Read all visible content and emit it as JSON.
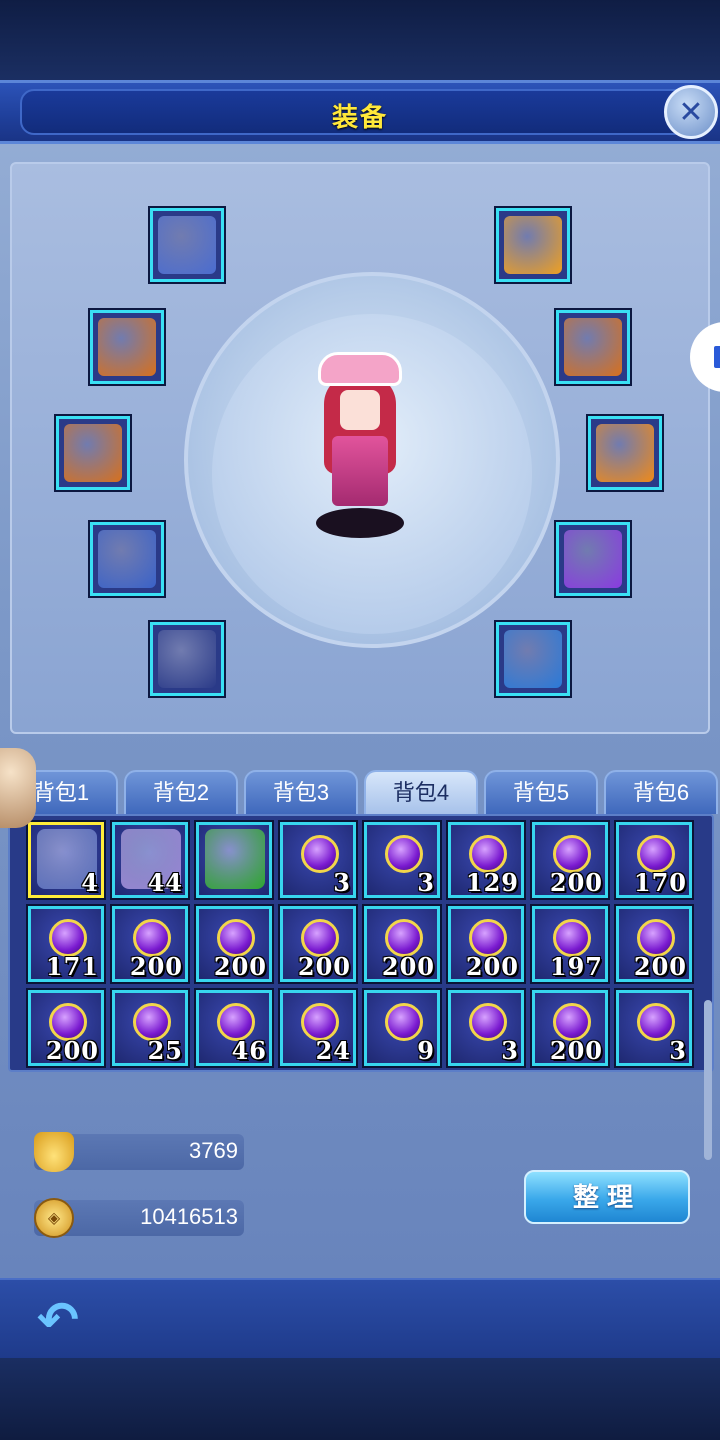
{
  "header": {
    "title": "装备"
  },
  "equipment": {
    "left": [
      {
        "name": "weapon-slot",
        "icon": "weapon-icon",
        "color": "#4a6cd0"
      },
      {
        "name": "necklace-slot",
        "icon": "jade-necklace-icon",
        "color": "#d8701c"
      },
      {
        "name": "armor-slot",
        "icon": "armor-icon",
        "color": "#d8701c"
      },
      {
        "name": "boots-slot",
        "icon": "boots-icon",
        "color": "#3a62c8"
      },
      {
        "name": "amulet-slot",
        "icon": "medallion-icon",
        "color": "#2a3a88"
      }
    ],
    "right": [
      {
        "name": "hat-slot",
        "icon": "hat-icon",
        "color": "#f0a020"
      },
      {
        "name": "robe-slot",
        "icon": "robe-icon",
        "color": "#d8701c"
      },
      {
        "name": "belt-slot",
        "icon": "belt-icon",
        "color": "#f08a18"
      },
      {
        "name": "bracer-slot",
        "icon": "bracer-icon",
        "color": "#8a3ae0"
      },
      {
        "name": "orb-slot",
        "icon": "yin-yang-orb-icon",
        "color": "#2a7ad8"
      }
    ]
  },
  "tabs": [
    "背包1",
    "背包2",
    "背包3",
    "背包4",
    "背包5",
    "背包6"
  ],
  "active_tab": 3,
  "bag": [
    {
      "icon": "sword-icon",
      "count": "4",
      "selected": true,
      "special": "#5a70c0"
    },
    {
      "icon": "ore-icon",
      "count": "44",
      "special": "#9a86d8"
    },
    {
      "icon": "green-rune-icon",
      "count": "",
      "special": "#2ea830"
    },
    {
      "icon": "purple-gem-icon",
      "count": "3"
    },
    {
      "icon": "purple-gem-icon",
      "count": "3"
    },
    {
      "icon": "purple-gem-icon",
      "count": "129"
    },
    {
      "icon": "purple-gem-icon",
      "count": "200"
    },
    {
      "icon": "purple-gem-icon",
      "count": "170"
    },
    {
      "icon": "purple-gem-icon",
      "count": "171"
    },
    {
      "icon": "purple-gem-icon",
      "count": "200"
    },
    {
      "icon": "purple-gem-icon",
      "count": "200"
    },
    {
      "icon": "purple-gem-icon",
      "count": "200"
    },
    {
      "icon": "purple-gem-icon",
      "count": "200"
    },
    {
      "icon": "purple-gem-icon",
      "count": "200"
    },
    {
      "icon": "purple-gem-icon",
      "count": "197"
    },
    {
      "icon": "purple-gem-icon",
      "count": "200"
    },
    {
      "icon": "purple-gem-icon",
      "count": "200"
    },
    {
      "icon": "purple-gem-icon",
      "count": "25"
    },
    {
      "icon": "purple-gem-icon",
      "count": "46"
    },
    {
      "icon": "purple-gem-icon",
      "count": "24"
    },
    {
      "icon": "purple-gem-icon",
      "count": "9"
    },
    {
      "icon": "purple-gem-icon",
      "count": "3"
    },
    {
      "icon": "purple-gem-icon",
      "count": "200"
    },
    {
      "icon": "purple-gem-icon",
      "count": "3"
    }
  ],
  "currency": {
    "ingot": "3769",
    "coins": "10416513"
  },
  "buttons": {
    "sort": "整理"
  }
}
